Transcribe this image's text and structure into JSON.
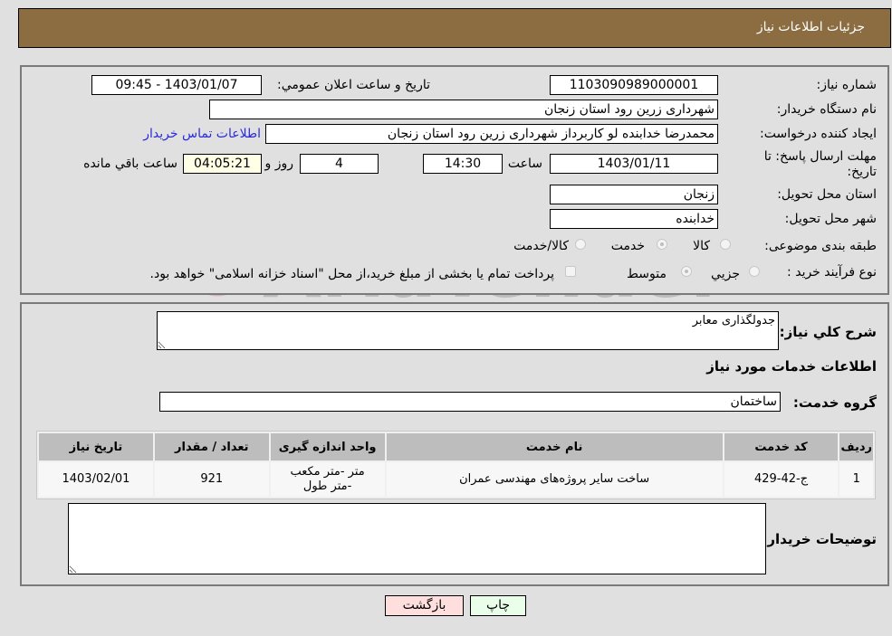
{
  "header": {
    "title": "جزئیات اطلاعات نیاز"
  },
  "form": {
    "need_number": {
      "label": "شماره نیاز:",
      "value": "1103090989000001"
    },
    "announce_datetime": {
      "label": "تاریخ و ساعت اعلان عمومي:",
      "value": "1403/01/07 - 09:45"
    },
    "buyer_org": {
      "label": "نام دستگاه خریدار:",
      "value": "شهرداری زرین رود استان زنجان"
    },
    "requester": {
      "label": "ایجاد کننده درخواست:",
      "value": "محمدرضا خدابنده لو کاربرداز شهرداری زرین رود استان زنجان"
    },
    "buyer_contact_link": "اطلاعات تماس خریدار",
    "deadline": {
      "label": "مهلت ارسال پاسخ: تا تاریخ:",
      "date": "1403/01/11",
      "time_label": "ساعت",
      "time": "14:30",
      "days": "4",
      "days_label": "روز و",
      "remaining": "04:05:21",
      "remaining_label": "ساعت باقي مانده"
    },
    "delivery_province": {
      "label": "استان محل تحویل:",
      "value": "زنجان"
    },
    "delivery_city": {
      "label": "شهر محل تحویل:",
      "value": "خدابنده"
    },
    "category": {
      "label": "طبقه بندی موضوعی:",
      "options": [
        "کالا",
        "خدمت",
        "کالا/خدمت"
      ],
      "selected": "خدمت"
    },
    "process_type": {
      "label": "نوع فرآیند خرید :",
      "options": [
        "جزیي",
        "متوسط"
      ],
      "selected": "متوسط",
      "treasury_note": "پرداخت تمام یا بخشی از مبلغ خرید،از محل \"اسناد خزانه اسلامی\" خواهد بود."
    }
  },
  "details": {
    "description_label": "شرح کلي نیاز:",
    "description_value": "جدولگذاری معابر",
    "services_heading": "اطلاعات خدمات مورد نیاز",
    "service_group_label": "گروه خدمت:",
    "service_group_value": "ساختمان",
    "table": {
      "headers": [
        "ردیف",
        "کد خدمت",
        "نام خدمت",
        "واحد اندازه گیری",
        "تعداد / مقدار",
        "تاریخ نیاز"
      ],
      "rows": [
        [
          "1",
          "ج-42-429",
          "ساخت سایر پروژه‌های مهندسی عمران",
          "متر -متر مکعب -متر طول",
          "921",
          "1403/02/01"
        ]
      ]
    },
    "buyer_notes_label": "توضیحات خریدار:",
    "buyer_notes_value": ""
  },
  "buttons": {
    "print": "چاپ",
    "back": "بازگشت"
  },
  "watermark": "AriaTender.net"
}
